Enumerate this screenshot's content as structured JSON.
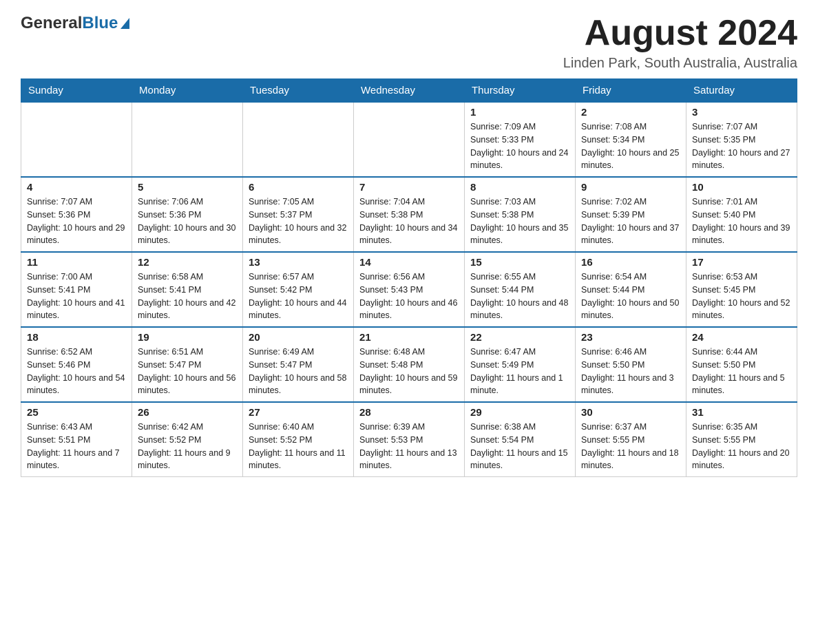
{
  "header": {
    "logo_general": "General",
    "logo_blue": "Blue",
    "month_title": "August 2024",
    "location": "Linden Park, South Australia, Australia"
  },
  "calendar": {
    "days_of_week": [
      "Sunday",
      "Monday",
      "Tuesday",
      "Wednesday",
      "Thursday",
      "Friday",
      "Saturday"
    ],
    "weeks": [
      [
        {
          "day": "",
          "info": ""
        },
        {
          "day": "",
          "info": ""
        },
        {
          "day": "",
          "info": ""
        },
        {
          "day": "",
          "info": ""
        },
        {
          "day": "1",
          "info": "Sunrise: 7:09 AM\nSunset: 5:33 PM\nDaylight: 10 hours and 24 minutes."
        },
        {
          "day": "2",
          "info": "Sunrise: 7:08 AM\nSunset: 5:34 PM\nDaylight: 10 hours and 25 minutes."
        },
        {
          "day": "3",
          "info": "Sunrise: 7:07 AM\nSunset: 5:35 PM\nDaylight: 10 hours and 27 minutes."
        }
      ],
      [
        {
          "day": "4",
          "info": "Sunrise: 7:07 AM\nSunset: 5:36 PM\nDaylight: 10 hours and 29 minutes."
        },
        {
          "day": "5",
          "info": "Sunrise: 7:06 AM\nSunset: 5:36 PM\nDaylight: 10 hours and 30 minutes."
        },
        {
          "day": "6",
          "info": "Sunrise: 7:05 AM\nSunset: 5:37 PM\nDaylight: 10 hours and 32 minutes."
        },
        {
          "day": "7",
          "info": "Sunrise: 7:04 AM\nSunset: 5:38 PM\nDaylight: 10 hours and 34 minutes."
        },
        {
          "day": "8",
          "info": "Sunrise: 7:03 AM\nSunset: 5:38 PM\nDaylight: 10 hours and 35 minutes."
        },
        {
          "day": "9",
          "info": "Sunrise: 7:02 AM\nSunset: 5:39 PM\nDaylight: 10 hours and 37 minutes."
        },
        {
          "day": "10",
          "info": "Sunrise: 7:01 AM\nSunset: 5:40 PM\nDaylight: 10 hours and 39 minutes."
        }
      ],
      [
        {
          "day": "11",
          "info": "Sunrise: 7:00 AM\nSunset: 5:41 PM\nDaylight: 10 hours and 41 minutes."
        },
        {
          "day": "12",
          "info": "Sunrise: 6:58 AM\nSunset: 5:41 PM\nDaylight: 10 hours and 42 minutes."
        },
        {
          "day": "13",
          "info": "Sunrise: 6:57 AM\nSunset: 5:42 PM\nDaylight: 10 hours and 44 minutes."
        },
        {
          "day": "14",
          "info": "Sunrise: 6:56 AM\nSunset: 5:43 PM\nDaylight: 10 hours and 46 minutes."
        },
        {
          "day": "15",
          "info": "Sunrise: 6:55 AM\nSunset: 5:44 PM\nDaylight: 10 hours and 48 minutes."
        },
        {
          "day": "16",
          "info": "Sunrise: 6:54 AM\nSunset: 5:44 PM\nDaylight: 10 hours and 50 minutes."
        },
        {
          "day": "17",
          "info": "Sunrise: 6:53 AM\nSunset: 5:45 PM\nDaylight: 10 hours and 52 minutes."
        }
      ],
      [
        {
          "day": "18",
          "info": "Sunrise: 6:52 AM\nSunset: 5:46 PM\nDaylight: 10 hours and 54 minutes."
        },
        {
          "day": "19",
          "info": "Sunrise: 6:51 AM\nSunset: 5:47 PM\nDaylight: 10 hours and 56 minutes."
        },
        {
          "day": "20",
          "info": "Sunrise: 6:49 AM\nSunset: 5:47 PM\nDaylight: 10 hours and 58 minutes."
        },
        {
          "day": "21",
          "info": "Sunrise: 6:48 AM\nSunset: 5:48 PM\nDaylight: 10 hours and 59 minutes."
        },
        {
          "day": "22",
          "info": "Sunrise: 6:47 AM\nSunset: 5:49 PM\nDaylight: 11 hours and 1 minute."
        },
        {
          "day": "23",
          "info": "Sunrise: 6:46 AM\nSunset: 5:50 PM\nDaylight: 11 hours and 3 minutes."
        },
        {
          "day": "24",
          "info": "Sunrise: 6:44 AM\nSunset: 5:50 PM\nDaylight: 11 hours and 5 minutes."
        }
      ],
      [
        {
          "day": "25",
          "info": "Sunrise: 6:43 AM\nSunset: 5:51 PM\nDaylight: 11 hours and 7 minutes."
        },
        {
          "day": "26",
          "info": "Sunrise: 6:42 AM\nSunset: 5:52 PM\nDaylight: 11 hours and 9 minutes."
        },
        {
          "day": "27",
          "info": "Sunrise: 6:40 AM\nSunset: 5:52 PM\nDaylight: 11 hours and 11 minutes."
        },
        {
          "day": "28",
          "info": "Sunrise: 6:39 AM\nSunset: 5:53 PM\nDaylight: 11 hours and 13 minutes."
        },
        {
          "day": "29",
          "info": "Sunrise: 6:38 AM\nSunset: 5:54 PM\nDaylight: 11 hours and 15 minutes."
        },
        {
          "day": "30",
          "info": "Sunrise: 6:37 AM\nSunset: 5:55 PM\nDaylight: 11 hours and 18 minutes."
        },
        {
          "day": "31",
          "info": "Sunrise: 6:35 AM\nSunset: 5:55 PM\nDaylight: 11 hours and 20 minutes."
        }
      ]
    ]
  }
}
